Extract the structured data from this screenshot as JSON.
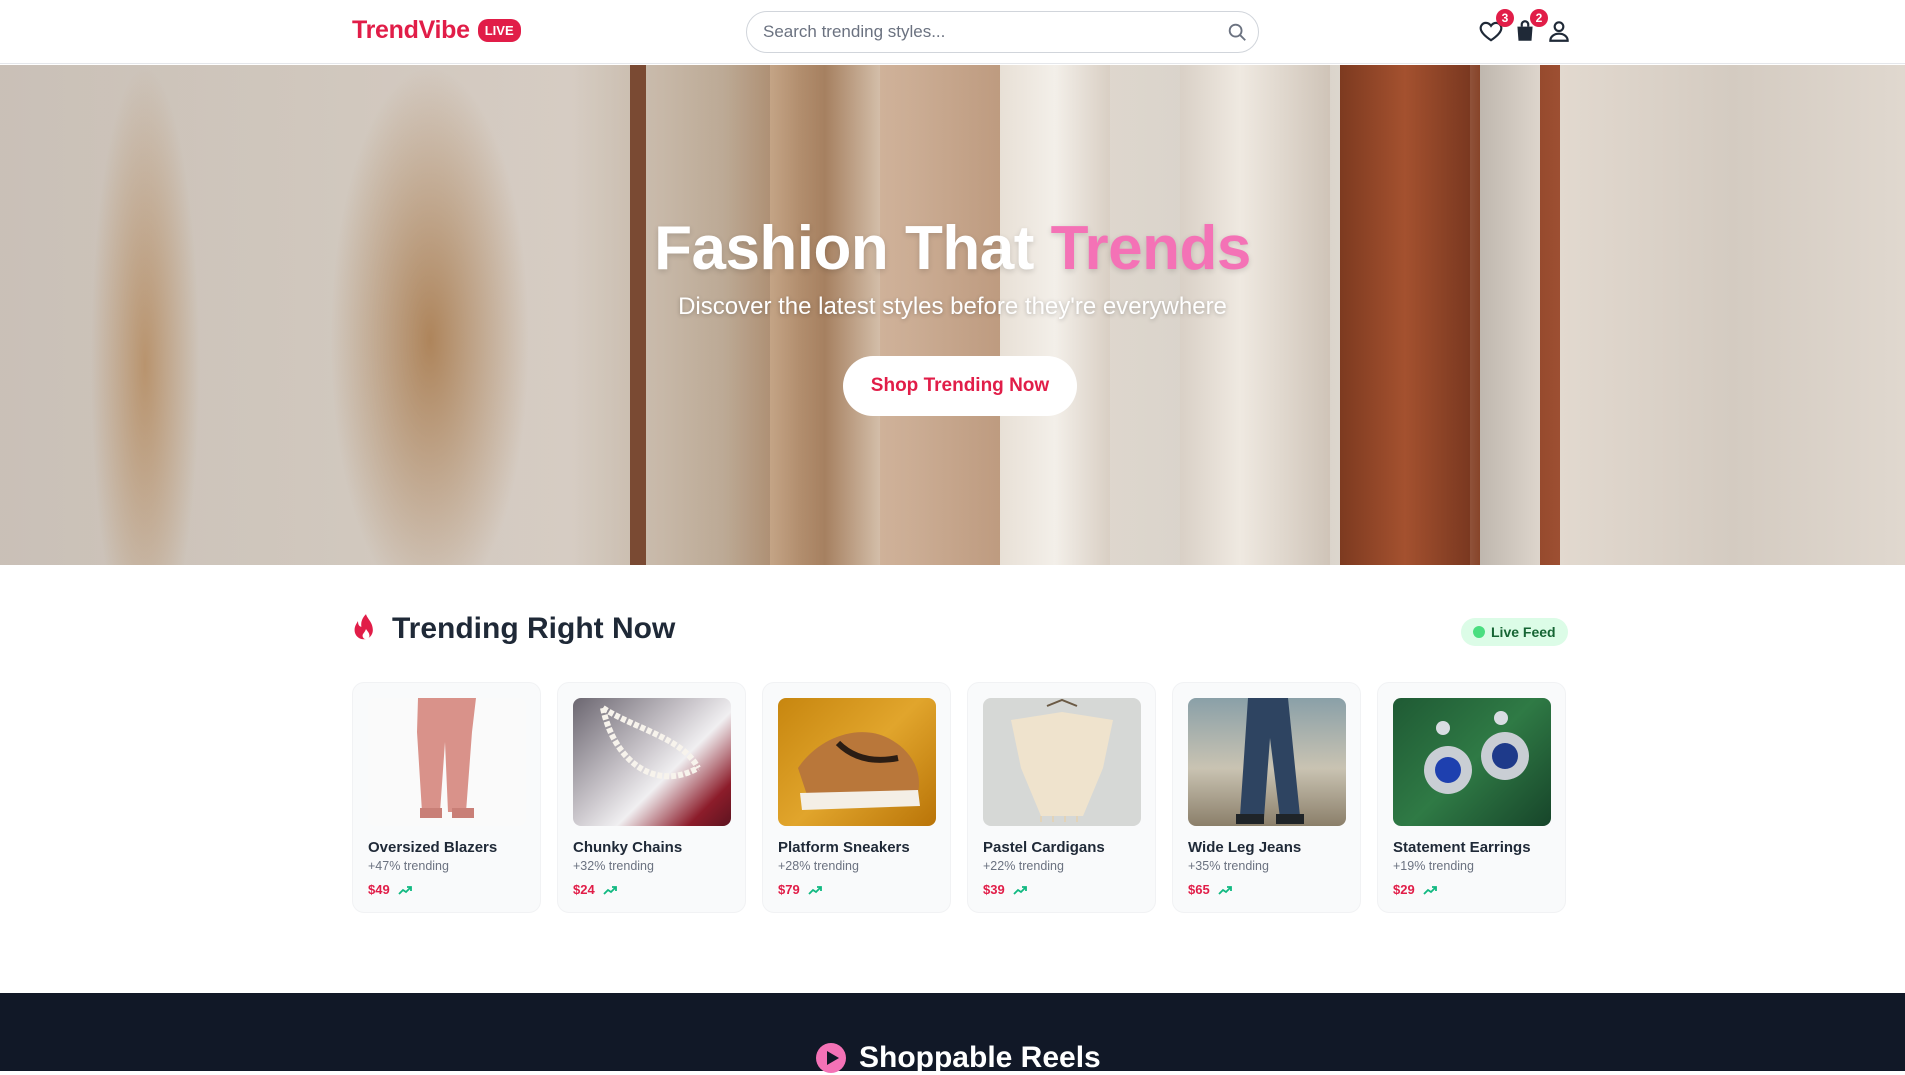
{
  "header": {
    "logo": "TrendVibe",
    "live_badge": "LIVE",
    "search_placeholder": "Search trending styles...",
    "wishlist_count": "3",
    "cart_count": "2"
  },
  "hero": {
    "title_main": "Fashion That ",
    "title_accent": "Trends",
    "subtitle": "Discover the latest styles before they're everywhere",
    "cta": "Shop Trending Now"
  },
  "trending": {
    "title": "Trending Right Now",
    "live_feed": "Live Feed",
    "items": [
      {
        "name": "Oversized Blazers",
        "trend": "+47% trending",
        "price": "$49"
      },
      {
        "name": "Chunky Chains",
        "trend": "+32% trending",
        "price": "$24"
      },
      {
        "name": "Platform Sneakers",
        "trend": "+28% trending",
        "price": "$79"
      },
      {
        "name": "Pastel Cardigans",
        "trend": "+22% trending",
        "price": "$39"
      },
      {
        "name": "Wide Leg Jeans",
        "trend": "+35% trending",
        "price": "$65"
      },
      {
        "name": "Statement Earrings",
        "trend": "+19% trending",
        "price": "$29"
      }
    ]
  },
  "reels": {
    "title": "Shoppable Reels"
  },
  "colors": {
    "brand": "#e11d48",
    "accent_pink": "#f472b6",
    "live_green": "#4ade80",
    "dark_section": "#111827"
  }
}
